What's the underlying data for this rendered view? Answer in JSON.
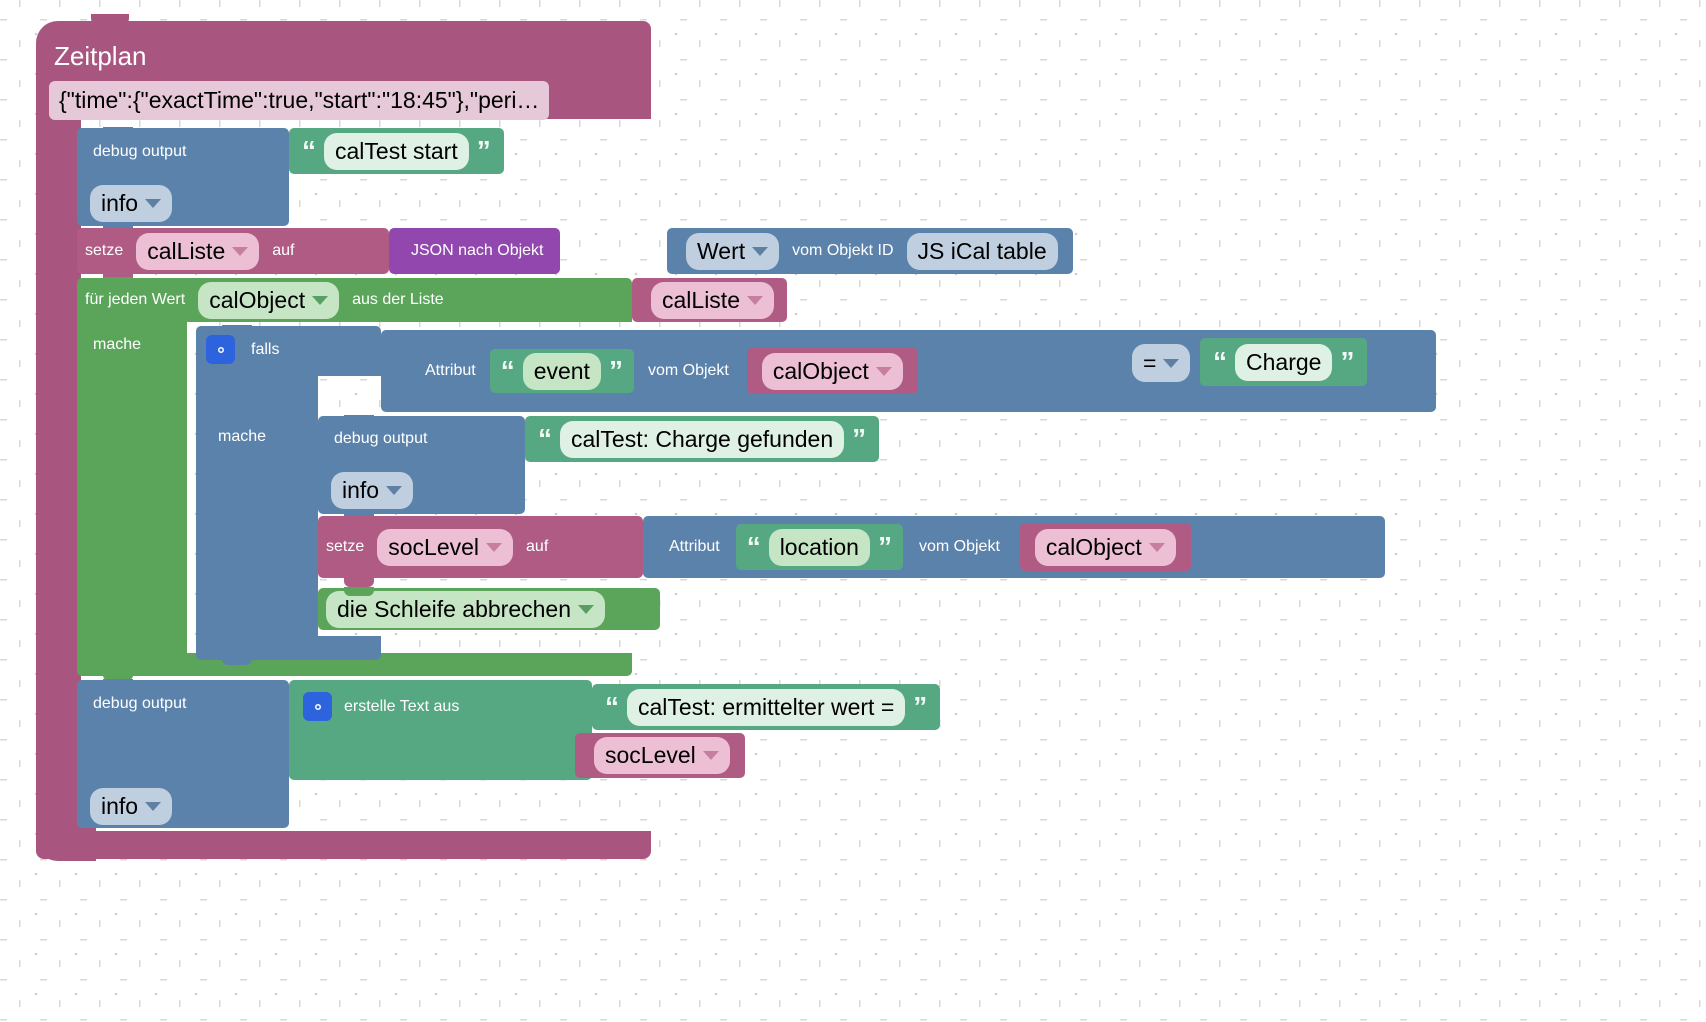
{
  "editor": {
    "kind": "blockly-workspace",
    "language": "de",
    "background_color": "#ffffff",
    "grid_color": "#d2d2d2"
  },
  "palette": {
    "schedule": "#a8567f",
    "variable": "#b05b84",
    "debug": "#5b82ab",
    "logic": "#5b82ab",
    "loop": "#5ba55b",
    "text": "#56a882",
    "convert": "#9147ad",
    "object": "#5b82ab"
  },
  "script": {
    "hat": {
      "title": "Zeitplan",
      "schedule_value": "{\"time\":{\"exactTime\":true,\"start\":\"18:45\"},\"peri…"
    },
    "statements": [
      {
        "id": "debug-start",
        "label": "debug output",
        "severity": "info",
        "text": "calTest start"
      },
      {
        "id": "set-calliste",
        "set_label": "setze",
        "variable": "calListe",
        "to_label": "auf",
        "convert_label": "JSON nach Objekt",
        "attribute": "Wert",
        "object_label": "vom Objekt ID",
        "object_id": "JS iCal table"
      },
      {
        "id": "foreach",
        "foreach_label": "für jeden Wert",
        "item_variable": "calObject",
        "list_label": "aus der Liste",
        "list_variable": "calListe",
        "do_label": "mache",
        "body": {
          "if": {
            "if_label": "falls",
            "condition": {
              "attribute_label": "Attribut",
              "attribute_name": "event",
              "object_label": "vom Objekt",
              "object_variable": "calObject",
              "operator": "=",
              "compare_value": "Charge"
            },
            "do_label": "mache",
            "body": [
              {
                "id": "debug-found",
                "label": "debug output",
                "severity": "info",
                "text": "calTest: Charge gefunden"
              },
              {
                "id": "set-soclevel",
                "set_label": "setze",
                "variable": "socLevel",
                "to_label": "auf",
                "attribute_label": "Attribut",
                "attribute_name": "location",
                "object_label": "vom Objekt",
                "object_variable": "calObject"
              },
              {
                "id": "break",
                "label": "die Schleife abbrechen"
              }
            ]
          }
        }
      },
      {
        "id": "debug-result",
        "label": "debug output",
        "severity": "info",
        "create_text_label": "erstelle Text aus",
        "text": "calTest: ermittelter wert =",
        "value_variable": "socLevel"
      }
    ]
  }
}
